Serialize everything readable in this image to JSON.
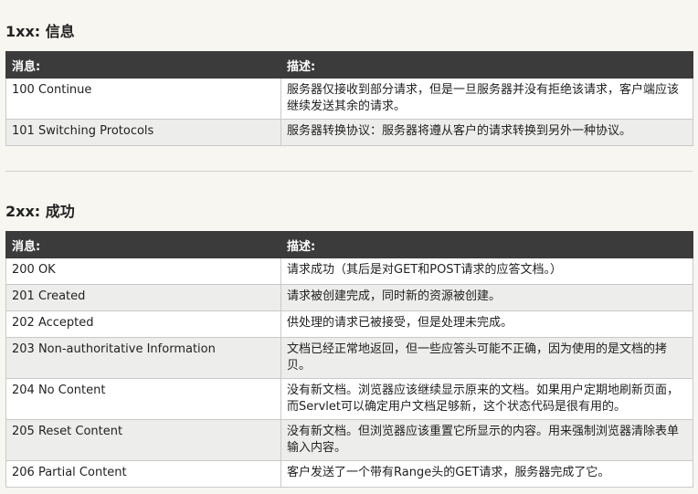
{
  "section1": {
    "title": "1xx: 信息",
    "headers": [
      "消息:",
      "描述:"
    ],
    "rows": [
      [
        "100 Continue",
        "服务器仅接收到部分请求，但是一旦服务器并没有拒绝该请求，客户端应该继续发送其余的请求。"
      ],
      [
        "101 Switching Protocols",
        "服务器转换协议：服务器将遵从客户的请求转换到另外一种协议。"
      ]
    ]
  },
  "section2": {
    "title": "2xx: 成功",
    "headers": [
      "消息:",
      "描述:"
    ],
    "rows": [
      [
        "200 OK",
        "请求成功（其后是对GET和POST请求的应答文档。）"
      ],
      [
        "201 Created",
        "请求被创建完成，同时新的资源被创建。"
      ],
      [
        "202 Accepted",
        "供处理的请求已被接受，但是处理未完成。"
      ],
      [
        "203 Non-authoritative Information",
        "文档已经正常地返回，但一些应答头可能不正确，因为使用的是文档的拷贝。"
      ],
      [
        "204 No Content",
        "没有新文档。浏览器应该继续显示原来的文档。如果用户定期地刷新页面，而Servlet可以确定用户文档足够新，这个状态代码是很有用的。"
      ],
      [
        "205 Reset Content",
        "没有新文档。但浏览器应该重置它所显示的内容。用来强制浏览器清除表单输入内容。"
      ],
      [
        "206 Partial Content",
        "客户发送了一个带有Range头的GET请求，服务器完成了它。"
      ]
    ]
  }
}
